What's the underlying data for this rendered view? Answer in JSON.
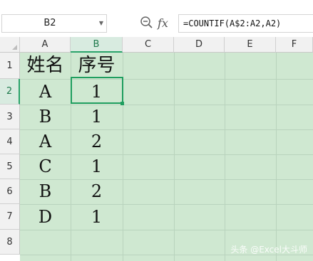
{
  "formula_bar": {
    "name_box": "B2",
    "fx_label": "fx",
    "formula": "=COUNTIF(A$2:A2,A2)"
  },
  "columns": [
    "A",
    "B",
    "C",
    "D",
    "E",
    "F"
  ],
  "rows": [
    "1",
    "2",
    "3",
    "4",
    "5",
    "6",
    "7",
    "8"
  ],
  "cells": {
    "A1": "姓名",
    "B1": "序号",
    "A2": "A",
    "B2": "1",
    "A3": "B",
    "B3": "1",
    "A4": "A",
    "B4": "2",
    "A5": "C",
    "B5": "1",
    "A6": "B",
    "B6": "2",
    "A7": "D",
    "B7": "1"
  },
  "selected_cell": "B2",
  "watermark": "头条 @Excel大斗师",
  "colors": {
    "cell_fill": "#cfe8d1",
    "selection": "#1f9e5f"
  }
}
